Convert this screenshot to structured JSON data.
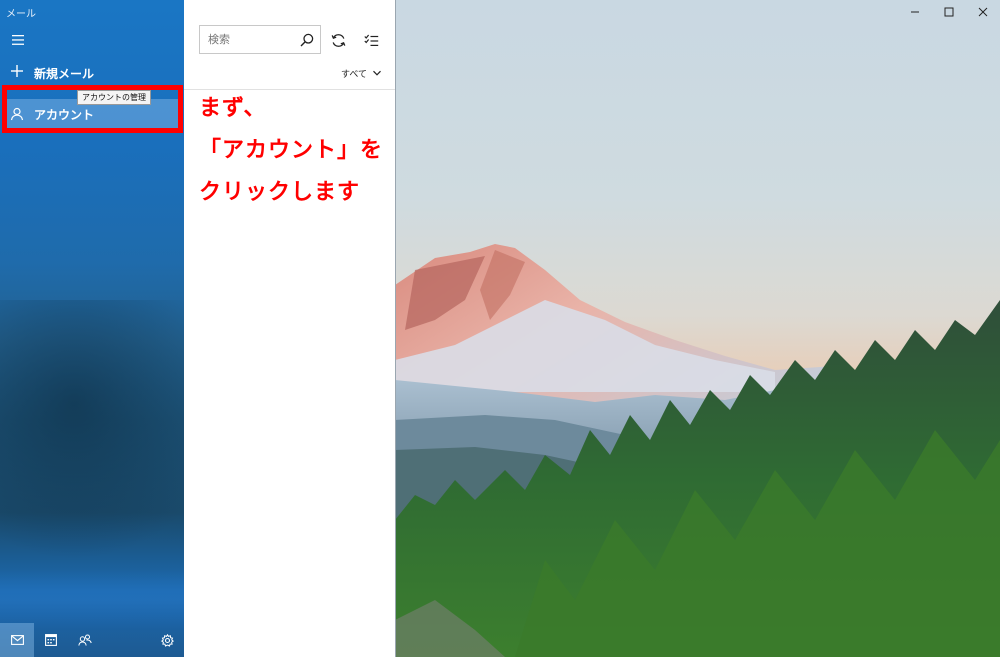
{
  "app": {
    "title": "メール"
  },
  "sidebar": {
    "new_mail_label": "新規メール",
    "account_label": "アカウント",
    "account_tooltip": "アカウントの管理",
    "bottom_icons": [
      "mail-icon",
      "calendar-icon",
      "people-icon",
      "settings-icon"
    ]
  },
  "list": {
    "search_placeholder": "検索",
    "filter_label": "すべて"
  },
  "instruction": {
    "line1": "まず、",
    "line2": "「アカウント」を",
    "line3": "クリックします"
  },
  "colors": {
    "sidebar_blue": "#1a76c4",
    "highlight_red": "#ff0000",
    "instruction_red": "#ff0000"
  }
}
